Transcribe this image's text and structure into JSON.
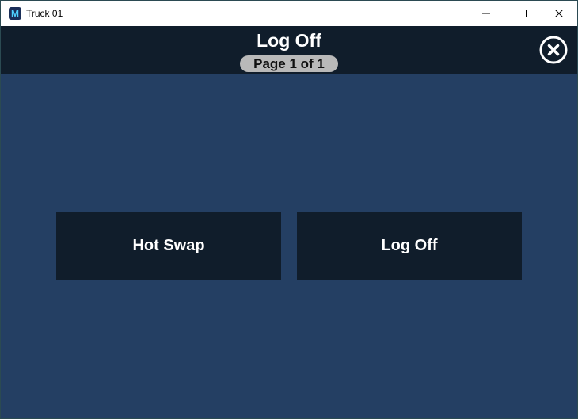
{
  "window": {
    "title": "Truck 01",
    "app_icon_letter": "M",
    "app_icon": "m-app-icon",
    "controls": [
      "minimize-icon",
      "maximize-icon",
      "close-icon"
    ]
  },
  "header": {
    "title": "Log Off",
    "page_indicator": "Page 1 of 1",
    "close_icon": "circle-x-icon"
  },
  "actions": [
    {
      "label": "Hot Swap"
    },
    {
      "label": "Log Off"
    }
  ],
  "colors": {
    "background": "#243f63",
    "header": "#101d2b",
    "button": "#101d2b",
    "badge": "#b9b9b9",
    "text": "#ffffff"
  }
}
